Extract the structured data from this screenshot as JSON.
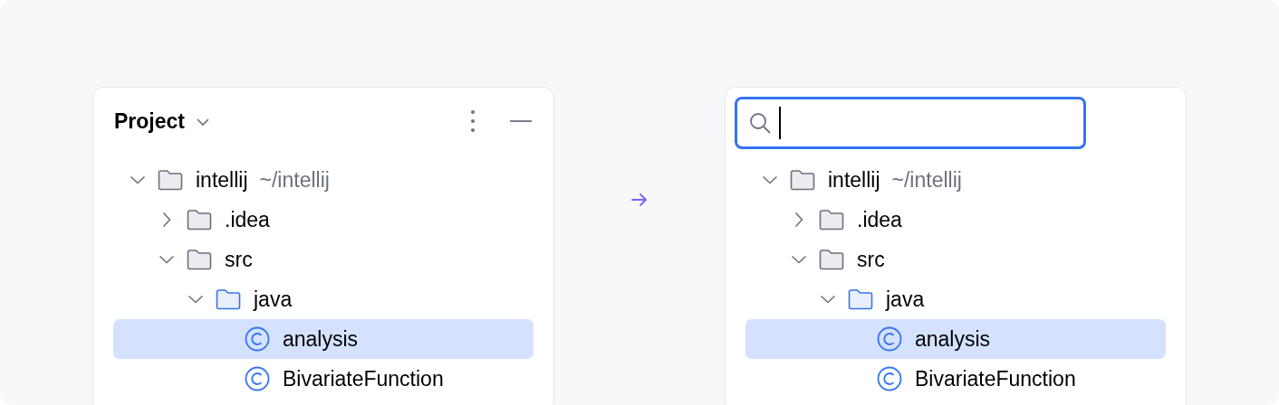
{
  "panels": [
    {
      "kind": "header",
      "title": "Project",
      "tree": [
        {
          "label": "intellij",
          "hint": "~/intellij",
          "kind": "folder",
          "expanded": true,
          "selected": false,
          "children": [
            {
              "label": ".idea",
              "kind": "folder",
              "expanded": false,
              "selected": false
            },
            {
              "label": "src",
              "kind": "folder",
              "expanded": true,
              "selected": false,
              "children": [
                {
                  "label": "java",
                  "kind": "source-folder",
                  "expanded": true,
                  "selected": false,
                  "children": [
                    {
                      "label": "analysis",
                      "kind": "class",
                      "selected": true
                    },
                    {
                      "label": "BivariateFunction",
                      "kind": "class",
                      "selected": false
                    }
                  ]
                }
              ]
            }
          ]
        }
      ]
    },
    {
      "kind": "search",
      "tree": [
        {
          "label": "intellij",
          "hint": "~/intellij",
          "kind": "folder",
          "expanded": true,
          "selected": false,
          "children": [
            {
              "label": ".idea",
              "kind": "folder",
              "expanded": false,
              "selected": false
            },
            {
              "label": "src",
              "kind": "folder",
              "expanded": true,
              "selected": false,
              "children": [
                {
                  "label": "java",
                  "kind": "source-folder",
                  "expanded": true,
                  "selected": false,
                  "children": [
                    {
                      "label": "analysis",
                      "kind": "class",
                      "selected": true
                    },
                    {
                      "label": "BivariateFunction",
                      "kind": "class",
                      "selected": false
                    }
                  ]
                }
              ]
            }
          ]
        }
      ]
    }
  ]
}
